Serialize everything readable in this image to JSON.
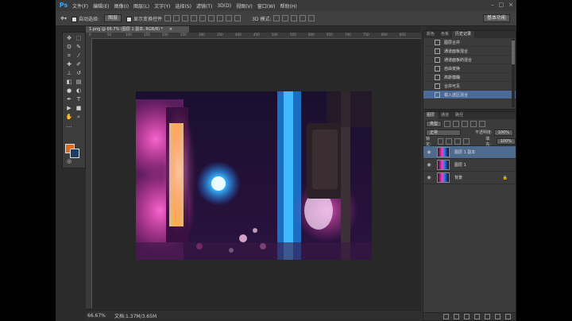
{
  "app": {
    "logo": "Ps",
    "menu": [
      "文件(F)",
      "编辑(E)",
      "图像(I)",
      "图层(L)",
      "文字(Y)",
      "选择(S)",
      "滤镜(T)",
      "3D(D)",
      "视图(V)",
      "窗口(W)",
      "帮助(H)"
    ],
    "window_controls": [
      "–",
      "□",
      "×"
    ]
  },
  "options_bar": {
    "auto_select_label": "自动选择:",
    "auto_select_value": "图层",
    "show_transform_label": "显示变换控件",
    "mode_3d_label": "3D 模式:",
    "workspace": "基本功能"
  },
  "document": {
    "tab_title": "1.png @ 66.7% (图层 1 副本, RGB/8) *",
    "tab_close": "×",
    "ruler_ticks": [
      "0",
      "50",
      "100",
      "150",
      "200",
      "250",
      "300",
      "350",
      "400",
      "450",
      "500",
      "550",
      "600",
      "650",
      "700",
      "750",
      "800",
      "850"
    ],
    "zoom": "66.67%",
    "doc_size": "文档:1.37M/3.65M"
  },
  "history_panel": {
    "tabs": [
      "颜色",
      "色板",
      "历史记录"
    ],
    "active_tab": 2,
    "items": [
      "图层合并",
      "通道面板混合",
      "通道面板的混合",
      "自由变换",
      "高斯模糊",
      "合并可见",
      "载入选区混合"
    ],
    "selected_index": 6
  },
  "layers_panel": {
    "tabs": [
      "图层",
      "通道",
      "路径"
    ],
    "filter_label": "类型",
    "blend_mode": "正常",
    "opacity_label": "不透明度:",
    "opacity_value": "100%",
    "lock_label": "锁定:",
    "fill_label": "填充:",
    "fill_value": "100%",
    "layers": [
      {
        "name": "图层 1 副本",
        "active": true,
        "locked": false
      },
      {
        "name": "图层 1",
        "active": false,
        "locked": false
      },
      {
        "name": "背景",
        "active": false,
        "locked": true
      }
    ]
  },
  "colors": {
    "foreground": "#e26b17",
    "background": "#1e3d63",
    "accent": "#31a8ff"
  }
}
